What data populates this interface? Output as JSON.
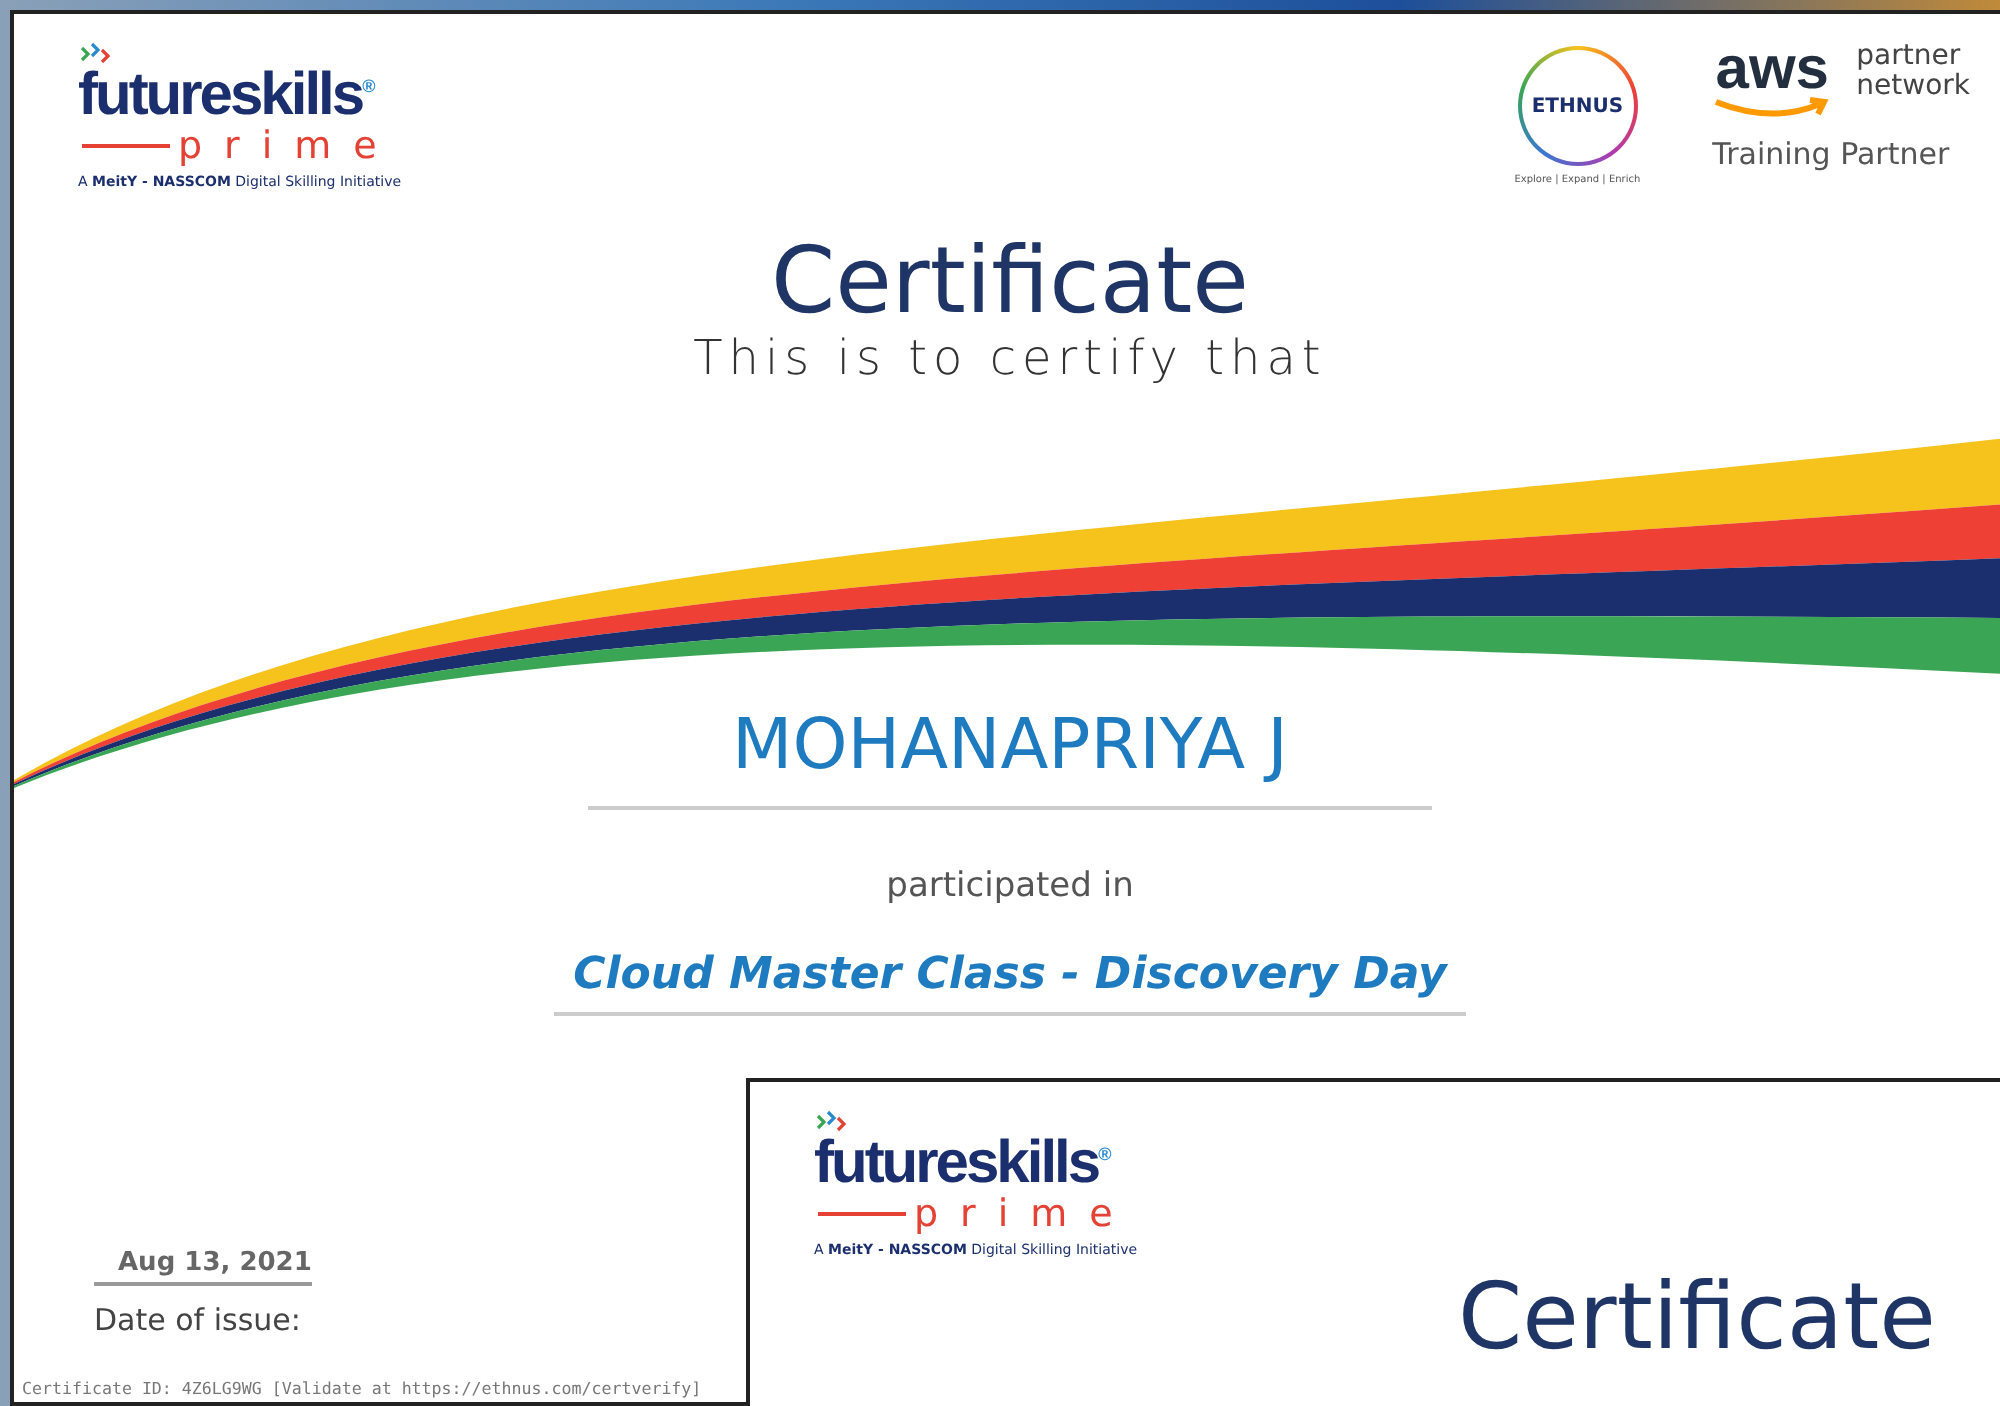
{
  "certificates": [
    {
      "logo": {
        "brand": "futureskills$^{®}$",
        "sub": "prime",
        "tagline": "A **MeitY - NASSCOM** Digital Skilling Initiative"
      },
      "partners": {
        "ethnus": "ETHNUS",
        "ethnus_tagline": "Explore | Expand | Enrich",
        "aws": "aws",
        "aws_line_1": "partner",
        "aws_line_2": "network",
        "aws_role": "Training Partner"
      },
      "title": "Certificate",
      "subtitle": "This is to certify that",
      "recipient": "MOHANAPRIYA J",
      "participation": "participated in",
      "course": "Cloud Master Class - Discovery Day",
      "issue_date": "Aug 13, 2021",
      "issue_date_label": "Date of issue:",
      "certificate_id": "Certificate ID: 4Z6LG9WG [Validate at https://ethnus.com/certverify]"
    },
    {
      "logo": {
        "brand": "futureskills$^{®}$",
        "sub": "prime",
        "tagline": "A **MeitY - NASSCOM** Digital Skilling Initiative"
      },
      "title": "Certificate"
    }
  ]
}
